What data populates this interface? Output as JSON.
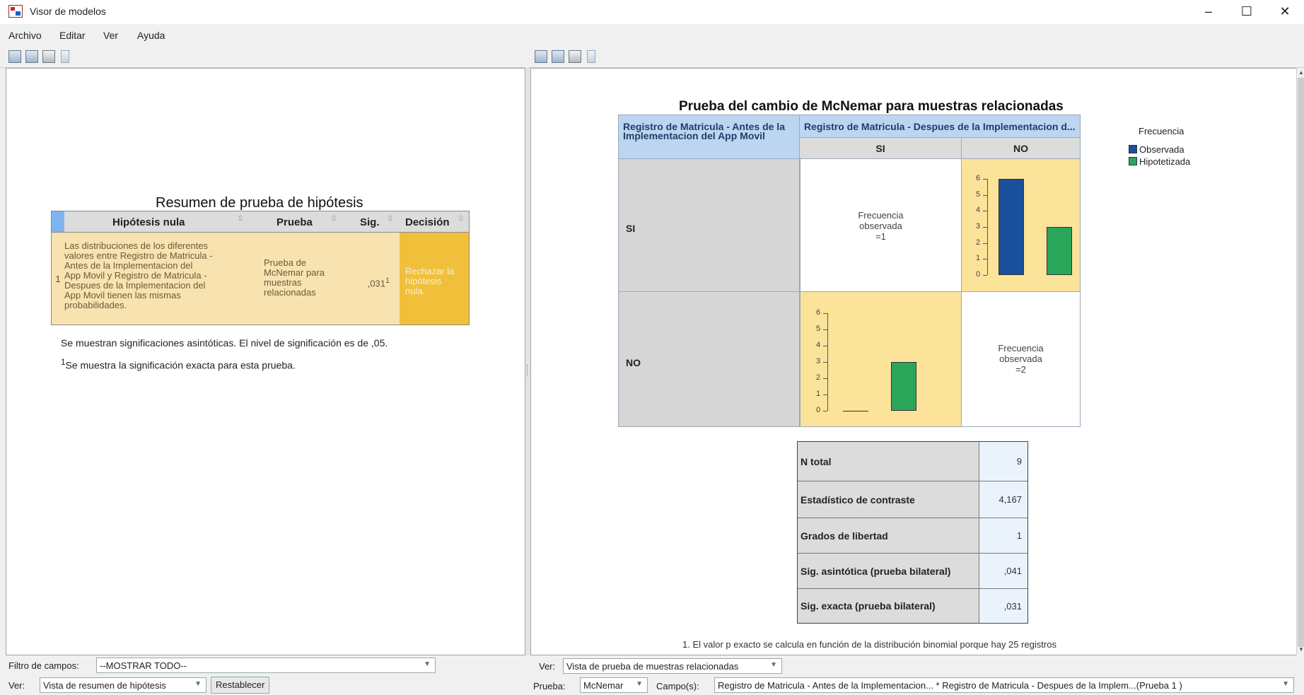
{
  "window": {
    "title": "Visor de modelos",
    "controls": {
      "minimize": "–",
      "maximize": "☐",
      "close": "✕"
    }
  },
  "menu": [
    "Archivo",
    "Editar",
    "Ver",
    "Ayuda"
  ],
  "left": {
    "summary": {
      "title": "Resumen de prueba de hipótesis",
      "headers": {
        "hypothesis": "Hipótesis nula",
        "test": "Prueba",
        "sig": "Sig.",
        "decision": "Decisión"
      },
      "row": {
        "num": "1",
        "hypothesis_lines": [
          "Las distribuciones de los diferentes",
          "valores entre Registro de Matricula -",
          "Antes de la Implementacion del",
          "App Movil y Registro de Matricula -",
          "Despues de la Implementacion del",
          "App Movil tienen las mismas",
          "probabilidades."
        ],
        "test_lines": [
          "Prueba de",
          "McNemar para",
          "muestras",
          "relacionadas"
        ],
        "sig": ",031",
        "sig_superscript": "1",
        "decision_lines": [
          "Rechazar la",
          "hipótesis",
          "nula."
        ]
      }
    },
    "note1": "Se muestran significaciones asintóticas.  El nivel de significación es de ,05.",
    "note2_sup": "1",
    "note2": "Se muestra la significación exacta para esta prueba."
  },
  "right": {
    "title": "Prueba del cambio de McNemar para muestras relacionadas",
    "row_header": "Registro de Matricula - Antes de la Implementacion del App Movil",
    "col_header": "Registro de Matricula - Despues de la Implementacion d...",
    "cols": [
      "SI",
      "NO"
    ],
    "rows": [
      "SI",
      "NO"
    ],
    "cell_si_si": [
      "Frecuencia",
      "observada",
      "=1"
    ],
    "cell_no_no": [
      "Frecuencia",
      "observada",
      "=2"
    ],
    "axis_ticks": [
      "6",
      "5",
      "4",
      "3",
      "2",
      "1",
      "0"
    ],
    "legend": {
      "title": "Frecuencia",
      "observed": "Observada",
      "hypothesized": "Hipotetizada",
      "observed_color": "#1a4f9c",
      "hypothesized_color": "#2aa65a"
    },
    "stats": [
      {
        "label": "N total",
        "value": "9"
      },
      {
        "label": "Estadístico de contraste",
        "value": "4,167"
      },
      {
        "label": "Grados de libertad",
        "value": "1"
      },
      {
        "label": "Sig. asintótica (prueba bilateral)",
        "value": ",041"
      },
      {
        "label": "Sig. exacta (prueba bilateral)",
        "value": ",031"
      }
    ],
    "footnote": "1.  El valor p exacto se calcula en función de la distribución binomial porque hay 25 registros"
  },
  "chart_data": [
    {
      "type": "bar",
      "cell": "Antes SI / Despues NO",
      "categories": [
        "Observada",
        "Hipotetizada"
      ],
      "values": [
        6,
        3
      ],
      "ylim": [
        0,
        6
      ]
    },
    {
      "type": "bar",
      "cell": "Antes NO / Despues SI",
      "categories": [
        "Observada",
        "Hipotetizada"
      ],
      "values": [
        0,
        3
      ],
      "ylim": [
        0,
        6
      ]
    }
  ],
  "bottom_left": {
    "filter_label": "Filtro de campos:",
    "filter_value": "--MOSTRAR TODO--",
    "view_label": "Ver:",
    "view_value": "Vista de resumen de hipótesis",
    "reset_button": "Restablecer"
  },
  "bottom_right": {
    "view_label": "Ver:",
    "view_value": "Vista de prueba de muestras relacionadas",
    "test_label": "Prueba:",
    "test_value": "McNemar",
    "fields_label": "Campo(s):",
    "fields_value": "Registro de Matricula - Antes de la Implementacion... * Registro de Matricula - Despues de la Implem...(Prueba 1 )"
  },
  "colors": {
    "accent_blue": "#1a4f9c",
    "accent_green": "#2aa65a",
    "highlight_yellow": "#fbe39a",
    "decision_orange": "#f0c03a"
  }
}
